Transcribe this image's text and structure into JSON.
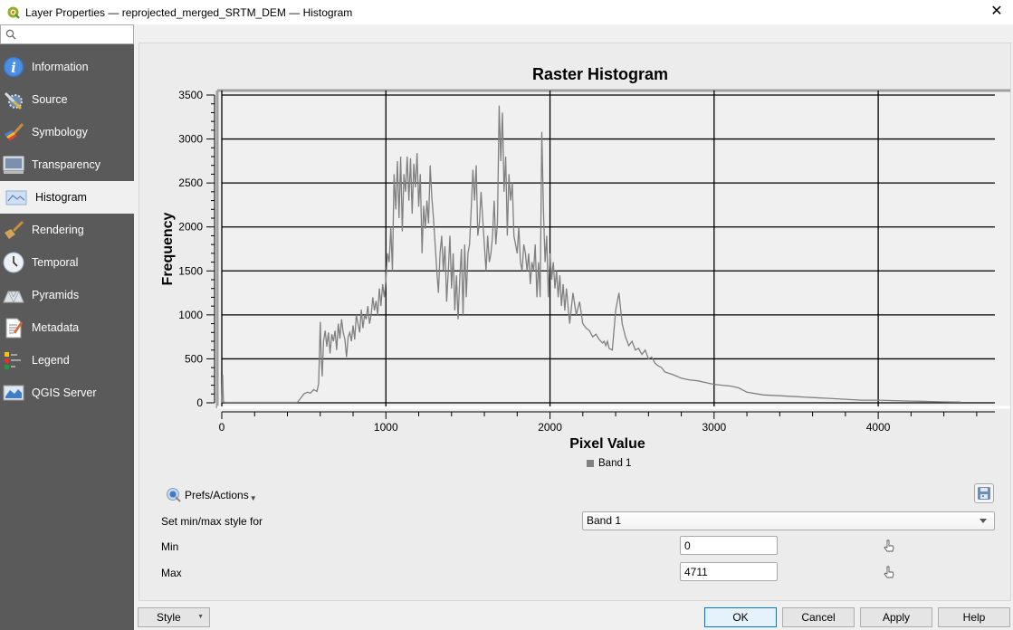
{
  "window": {
    "title": "Layer Properties — reprojected_merged_SRTM_DEM — Histogram",
    "close_icon": "close-icon"
  },
  "sidebar": {
    "search_placeholder": "",
    "items": [
      {
        "label": "Information",
        "icon": "info-icon",
        "active": false
      },
      {
        "label": "Source",
        "icon": "source-wrench-icon",
        "active": false
      },
      {
        "label": "Symbology",
        "icon": "symbology-brush-icon",
        "active": false
      },
      {
        "label": "Transparency",
        "icon": "transparency-icon",
        "active": false
      },
      {
        "label": "Histogram",
        "icon": "histogram-icon",
        "active": true
      },
      {
        "label": "Rendering",
        "icon": "rendering-brush-icon",
        "active": false
      },
      {
        "label": "Temporal",
        "icon": "clock-icon",
        "active": false
      },
      {
        "label": "Pyramids",
        "icon": "pyramids-icon",
        "active": false
      },
      {
        "label": "Metadata",
        "icon": "metadata-icon",
        "active": false
      },
      {
        "label": "Legend",
        "icon": "legend-icon",
        "active": false
      },
      {
        "label": "QGIS Server",
        "icon": "qgis-server-icon",
        "active": false
      }
    ]
  },
  "histogram": {
    "prefs_label": "Prefs/Actions",
    "set_minmax_label": "Set min/max style for",
    "band_selected": "Band 1",
    "min_label": "Min",
    "min_value": "0",
    "max_label": "Max",
    "max_value": "4711"
  },
  "footer": {
    "style_label": "Style",
    "ok_label": "OK",
    "cancel_label": "Cancel",
    "apply_label": "Apply",
    "help_label": "Help"
  },
  "colors": {
    "series": "#808080",
    "sidebar_bg": "#5a5a5a",
    "accent": "#0078d7"
  },
  "chart_data": {
    "type": "line",
    "title": "Raster Histogram",
    "xlabel": "Pixel Value",
    "ylabel": "Frequency",
    "xlim": [
      0,
      4711
    ],
    "ylim": [
      0,
      3500
    ],
    "xticks": [
      0,
      1000,
      2000,
      3000,
      4000
    ],
    "yticks": [
      0,
      500,
      1000,
      1500,
      2000,
      2500,
      3000,
      3500
    ],
    "grid": true,
    "legend": "bottom-center",
    "series": [
      {
        "name": "Band 1",
        "x": [
          0,
          5,
          10,
          20,
          100,
          200,
          300,
          400,
          460,
          480,
          500,
          520,
          540,
          560,
          580,
          590,
          600,
          605,
          612,
          620,
          630,
          640,
          650,
          660,
          670,
          680,
          690,
          700,
          710,
          720,
          730,
          740,
          750,
          760,
          770,
          780,
          790,
          800,
          810,
          820,
          830,
          840,
          850,
          860,
          870,
          880,
          890,
          900,
          910,
          920,
          930,
          940,
          950,
          960,
          970,
          980,
          990,
          1000,
          1010,
          1020,
          1030,
          1040,
          1050,
          1060,
          1070,
          1080,
          1090,
          1100,
          1110,
          1120,
          1130,
          1140,
          1150,
          1160,
          1170,
          1180,
          1190,
          1200,
          1210,
          1220,
          1230,
          1240,
          1250,
          1260,
          1270,
          1280,
          1290,
          1300,
          1310,
          1320,
          1330,
          1340,
          1350,
          1360,
          1370,
          1380,
          1390,
          1400,
          1410,
          1420,
          1430,
          1440,
          1450,
          1460,
          1470,
          1480,
          1490,
          1500,
          1510,
          1520,
          1530,
          1540,
          1550,
          1560,
          1570,
          1580,
          1590,
          1600,
          1610,
          1620,
          1630,
          1640,
          1650,
          1660,
          1670,
          1680,
          1690,
          1700,
          1710,
          1720,
          1730,
          1740,
          1750,
          1760,
          1770,
          1780,
          1790,
          1800,
          1810,
          1820,
          1830,
          1840,
          1850,
          1860,
          1870,
          1880,
          1890,
          1900,
          1910,
          1920,
          1930,
          1940,
          1950,
          1960,
          1970,
          1980,
          1990,
          2000,
          2010,
          2020,
          2030,
          2040,
          2050,
          2060,
          2070,
          2080,
          2090,
          2100,
          2120,
          2140,
          2160,
          2180,
          2200,
          2220,
          2240,
          2260,
          2280,
          2300,
          2320,
          2330,
          2340,
          2350,
          2360,
          2380,
          2400,
          2420,
          2440,
          2460,
          2480,
          2500,
          2520,
          2540,
          2560,
          2580,
          2600,
          2620,
          2640,
          2660,
          2680,
          2700,
          2750,
          2800,
          2850,
          2900,
          2950,
          3000,
          3050,
          3100,
          3150,
          3200,
          3300,
          3400,
          3500,
          3600,
          3700,
          3800,
          3900,
          4000,
          4100,
          4200,
          4300,
          4400,
          4500,
          4600,
          4711
        ],
        "values": [
          0,
          320,
          10,
          5,
          5,
          5,
          5,
          5,
          5,
          50,
          100,
          120,
          110,
          150,
          130,
          220,
          920,
          560,
          300,
          700,
          820,
          640,
          800,
          560,
          780,
          700,
          820,
          600,
          900,
          730,
          950,
          800,
          720,
          520,
          750,
          800,
          700,
          880,
          720,
          1000,
          900,
          800,
          1060,
          850,
          1000,
          950,
          1100,
          900,
          1000,
          1200,
          1050,
          1160,
          1000,
          1300,
          1100,
          1350,
          1200,
          1400,
          1700,
          1600,
          2000,
          1500,
          2600,
          2200,
          2750,
          2100,
          2800,
          1950,
          2600,
          2400,
          2800,
          2300,
          2780,
          2150,
          2720,
          2450,
          2840,
          2230,
          2600,
          1700,
          2240,
          1980,
          2300,
          2040,
          2700,
          2340,
          2100,
          1800,
          1500,
          1250,
          1700,
          1900,
          1500,
          1780,
          1150,
          1500,
          1900,
          1300,
          1700,
          1050,
          1450,
          950,
          1420,
          1750,
          1000,
          1800,
          1200,
          1700,
          1800,
          2200,
          2650,
          2300,
          2700,
          1900,
          2050,
          2400,
          2100,
          1800,
          1500,
          1900,
          1600,
          1700,
          1900,
          2300,
          1800,
          2050,
          3380,
          2750,
          3300,
          2400,
          2800,
          1900,
          2600,
          2300,
          2500,
          1900,
          1800,
          1700,
          2000,
          1600,
          1500,
          1800,
          1700,
          1500,
          1700,
          1350,
          1600,
          1500,
          1800,
          1200,
          1600,
          1200,
          3080,
          2200,
          1600,
          1900,
          1200,
          1700,
          1400,
          1600,
          1300,
          1500,
          1200,
          1450,
          1100,
          1350,
          1050,
          1300,
          900,
          1250,
          1000,
          1150,
          900,
          850,
          820,
          750,
          780,
          720,
          680,
          700,
          650,
          700,
          620,
          600,
          1050,
          1250,
          900,
          750,
          650,
          700,
          600,
          620,
          550,
          600,
          500,
          520,
          450,
          420,
          400,
          350,
          320,
          280,
          260,
          250,
          230,
          210,
          200,
          190,
          170,
          120,
          90,
          80,
          70,
          60,
          50,
          40,
          30,
          30,
          25,
          20,
          15,
          10,
          8
        ]
      }
    ]
  }
}
